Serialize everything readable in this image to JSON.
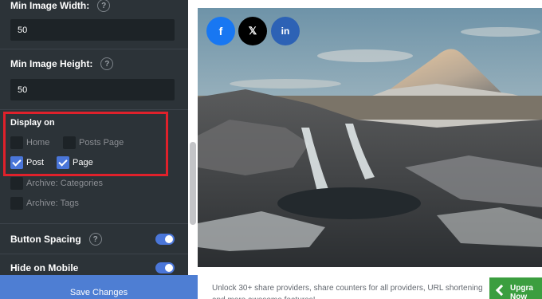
{
  "settings": {
    "min_width_label": "Min Image Width:",
    "min_width_value": "50",
    "min_height_label": "Min Image Height:",
    "min_height_value": "50",
    "display_on_label": "Display on",
    "display_options": [
      {
        "label": "Home",
        "checked": false
      },
      {
        "label": "Posts Page",
        "checked": false
      },
      {
        "label": "Post",
        "checked": true
      },
      {
        "label": "Page",
        "checked": true
      },
      {
        "label": "Archive: Categories",
        "checked": false
      },
      {
        "label": "Archive: Tags",
        "checked": false
      }
    ],
    "button_spacing_label": "Button Spacing",
    "button_spacing_on": true,
    "hide_mobile_label": "Hide on Mobile",
    "hide_mobile_on": true,
    "help_glyph": "?",
    "save_label": "Save Changes"
  },
  "share_buttons": [
    {
      "name": "facebook",
      "icon": "facebook-icon",
      "glyph": "f",
      "color": "#1877f2"
    },
    {
      "name": "x",
      "icon": "x-icon",
      "glyph": "𝕏",
      "color": "#000000"
    },
    {
      "name": "linkedin",
      "icon": "linkedin-icon",
      "glyph": "in",
      "color": "#2d62b5"
    }
  ],
  "promo": {
    "text": "Unlock 30+ share providers, share counters for all providers, URL shortening and more awesome features!",
    "upgrade_line1": "Upgra",
    "upgrade_line2": "Now"
  },
  "colors": {
    "accent": "#4a76d9",
    "highlight": "#e0212b",
    "panel": "#2c3338",
    "upgrade": "#3b9e3f"
  }
}
